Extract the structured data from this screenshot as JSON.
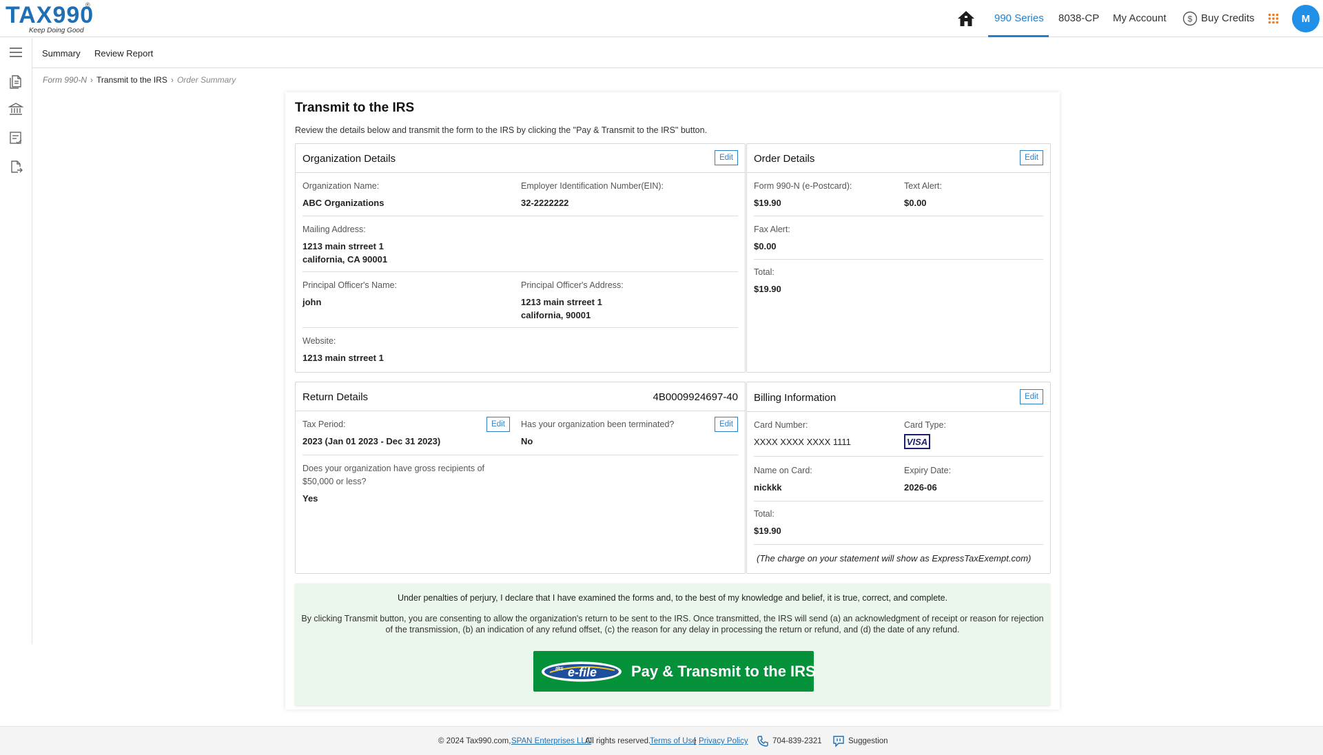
{
  "header": {
    "logo_text": "TAX990",
    "logo_reg": "®",
    "logo_tagline": "Keep Doing Good",
    "nav": [
      "990 Series",
      "8038-CP",
      "My Account",
      "Buy Credits"
    ],
    "active_nav": "990 Series",
    "avatar_initial": "M",
    "icons": [
      "home-icon",
      "dollar-coin-icon",
      "apps-grid-icon"
    ]
  },
  "siderail": {
    "icons": [
      "menu-icon",
      "document-icon",
      "bank-icon",
      "checklist-icon",
      "file-export-icon"
    ]
  },
  "subnav": {
    "items": [
      "Summary",
      "Review Report"
    ]
  },
  "breadcrumb": [
    "Form 990-N",
    "Transmit to the IRS",
    "Order Summary"
  ],
  "page": {
    "title": "Transmit to the IRS",
    "intro": "Review the details below and transmit the form to the IRS by clicking the \"Pay & Transmit to the IRS\" button."
  },
  "organization": {
    "title": "Organization Details",
    "edit": "Edit",
    "name_label": "Organization Name:",
    "name": "ABC Organizations",
    "ein_label": "Employer Identification Number(EIN):",
    "ein": "32-2222222",
    "address_label": "Mailing Address:",
    "address_line1": "1213 main strreet 1",
    "address_line2": "california, CA 90001",
    "officer_name_label": "Principal Officer's Name:",
    "officer_name": "john",
    "officer_address_label": "Principal Officer's Address:",
    "officer_address_line1": "1213 main strreet 1",
    "officer_address_line2": "california, 90001",
    "website_label": "Website:",
    "website": "1213 main strreet 1"
  },
  "order": {
    "title": "Order Details",
    "edit": "Edit",
    "form_label": "Form 990-N (e-Postcard):",
    "form_value": "$19.90",
    "text_alert_label": "Text Alert:",
    "text_alert_value": "$0.00",
    "fax_alert_label": "Fax Alert:",
    "fax_alert_value": "$0.00",
    "total_label": "Total:",
    "total_value": "$19.90"
  },
  "return": {
    "title": "Return Details",
    "return_id": "4B0009924697-40",
    "edit": "Edit",
    "tax_period_label": "Tax Period:",
    "tax_period": "2023 (Jan 01 2023 - Dec 31 2023)",
    "terminated_label": "Has your organization been terminated?",
    "terminated": "No",
    "gross_label_line1": "Does your organization have gross recipients of",
    "gross_label_line2": "$50,000 or less?",
    "gross": "Yes"
  },
  "billing": {
    "title": "Billing Information",
    "edit": "Edit",
    "card_number_label": "Card Number:",
    "card_number": "XXXX XXXX XXXX 1111",
    "card_type_label": "Card Type:",
    "card_type": "VISA",
    "name_label": "Name on Card:",
    "name": "nickkk",
    "expiry_label": "Expiry Date:",
    "expiry": "2026-06",
    "total_label": "Total:",
    "total": "$19.90",
    "statement_note": "(The charge on your statement will show as ExpressTaxExempt.com)"
  },
  "declaration": {
    "line1": "Under penalties of perjury, I declare that I have examined the forms and, to the best of my knowledge and belief, it is true, correct, and complete.",
    "line2": "By clicking Transmit button, you are consenting to allow the organization's return to be sent to the IRS. Once transmitted, the IRS will send (a) an acknowledgment of receipt or reason for rejection of the transmission, (b) an indication of any refund offset, (c) the reason for any delay in processing the return or refund, and (d) the date of any refund.",
    "button_label": "Pay & Transmit to the IRS",
    "badge_text": "e-file",
    "badge_small": "IRS"
  },
  "footer": {
    "copyright": "© 2024 Tax990.com,",
    "company_link": "SPAN Enterprises LLC",
    "rights": "All rights reserved.",
    "terms": "Terms of Use",
    "divider": "|",
    "privacy": "Privacy Policy",
    "phone": "704-839-2321",
    "suggestion": "Suggestion"
  },
  "colors": {
    "brand_blue": "#1f6fb5",
    "active_nav": "#1f7fd1",
    "transmit_green": "#05903a",
    "declaration_bg": "#ebf6ec"
  }
}
